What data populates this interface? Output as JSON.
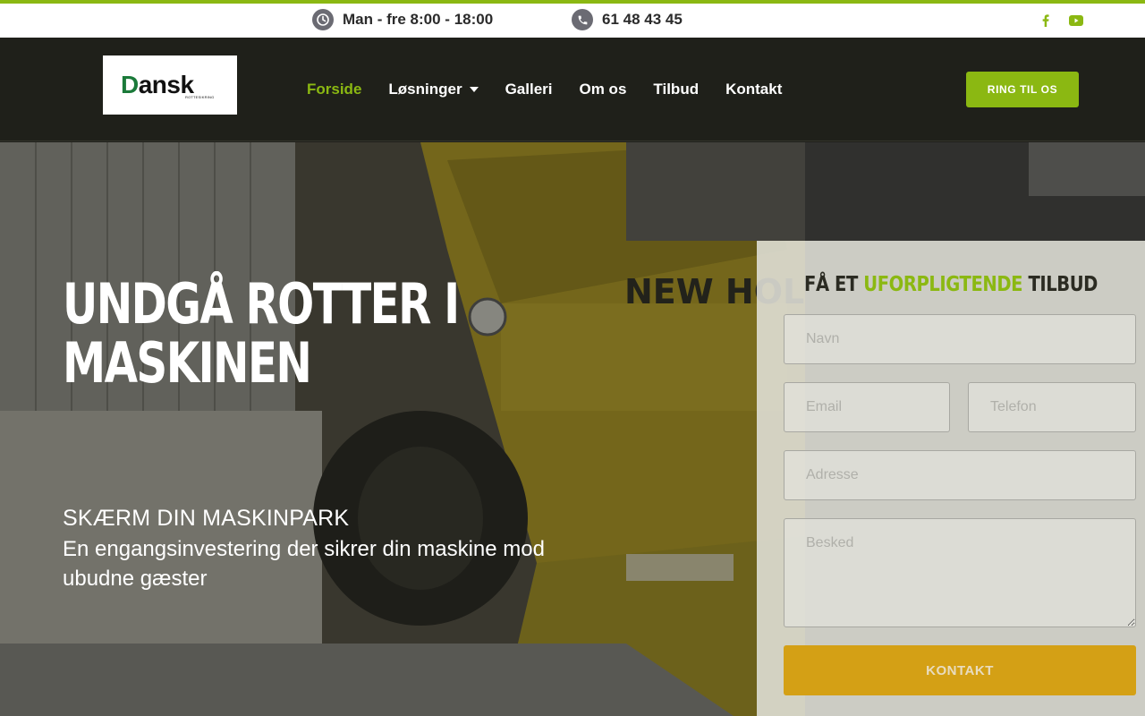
{
  "topbar": {
    "hours_icon": "clock-icon",
    "hours": "Man - fre 8:00 - 18:00",
    "phone_icon": "phone-icon",
    "phone": "61 48 43 45",
    "social": [
      "facebook-icon",
      "youtube-icon"
    ],
    "accent_color": "#8bb812"
  },
  "header": {
    "logo_main": "Dansk",
    "logo_first_letter": "D",
    "logo_rest": "ansk",
    "logo_sub": "ROTTESIKRING",
    "nav": [
      {
        "label": "Forside",
        "active": true
      },
      {
        "label": "Løsninger",
        "dropdown": true
      },
      {
        "label": "Galleri"
      },
      {
        "label": "Om os"
      },
      {
        "label": "Tilbud"
      },
      {
        "label": "Kontakt"
      }
    ],
    "cta": "RING TIL OS"
  },
  "hero": {
    "title": "UNDGÅ ROTTER I MASKINEN",
    "subtitle": "SKÆRM DIN MASKINPARK",
    "description": "En engangsinvestering der sikrer din maskine mod ubudne gæster",
    "bg_text": "NEW HOLLAND"
  },
  "form": {
    "title_pre": "FÅ ET ",
    "title_highlight": "UFORPLIGTENDE",
    "title_post": " TILBUD",
    "fields": {
      "navn": "Navn",
      "email": "Email",
      "telefon": "Telefon",
      "adresse": "Adresse",
      "besked": "Besked"
    },
    "submit": "KONTAKT",
    "submit_color": "#d4a015"
  }
}
